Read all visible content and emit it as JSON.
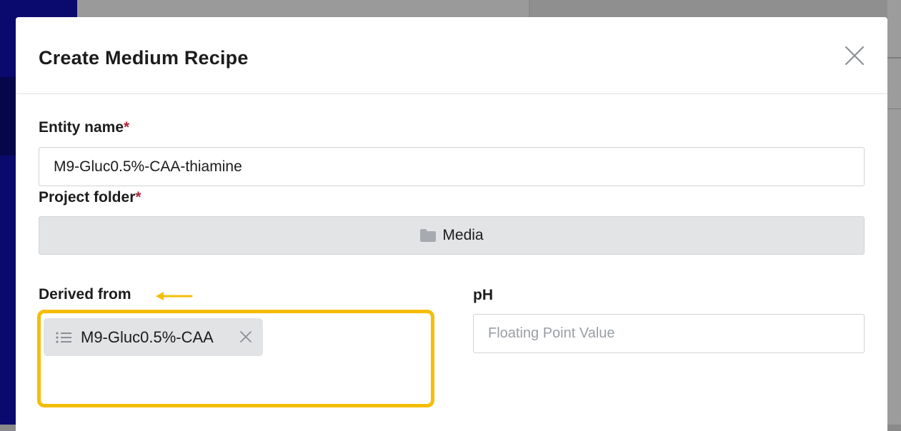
{
  "modal": {
    "title": "Create Medium Recipe"
  },
  "fields": {
    "entity_name": {
      "label": "Entity name",
      "required_mark": "*",
      "value": "M9-Gluc0.5%-CAA-thiamine"
    },
    "project_folder": {
      "label": "Project folder",
      "required_mark": "*",
      "value": "Media",
      "icon": "folder-icon"
    },
    "derived_from": {
      "label": "Derived from",
      "chips": [
        {
          "label": "M9-Gluc0.5%-CAA",
          "icon": "list-icon"
        }
      ]
    },
    "ph": {
      "label": "pH",
      "placeholder": "Floating Point Value",
      "value": ""
    }
  },
  "annotation": {
    "highlight_color": "#f5bd09",
    "arrow_color": "#f5bd09"
  },
  "colors": {
    "required": "#b0253a",
    "folder_button_bg": "#e3e4e6",
    "chip_bg": "#e2e3e5",
    "overlay_left": "#0a0a6e"
  }
}
